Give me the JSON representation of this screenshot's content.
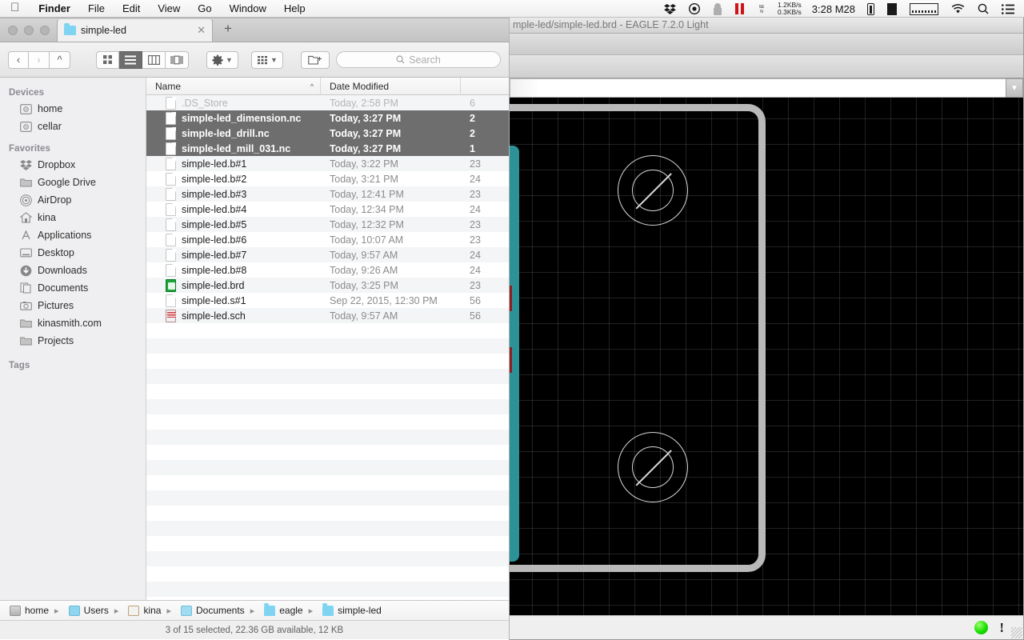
{
  "menubar": {
    "apple_icon": "apple-logo-icon",
    "items": [
      {
        "label": "Finder",
        "bold": true
      },
      {
        "label": "File",
        "bold": false
      },
      {
        "label": "Edit",
        "bold": false
      },
      {
        "label": "View",
        "bold": false
      },
      {
        "label": "Go",
        "bold": false
      },
      {
        "label": "Window",
        "bold": false
      },
      {
        "label": "Help",
        "bold": false
      }
    ],
    "status_icons": [
      "dropbox-icon",
      "record-circle-icon",
      "lock-icon",
      "pause-icon",
      "text-widget-icon"
    ],
    "network_up": "1.2KB/s",
    "network_down": "0.3KB/s",
    "clock": "3:28 M28",
    "right_icons": [
      "battery-icon",
      "black-box-icon",
      "activity-graph-icon",
      "wifi-icon",
      "search-icon",
      "notification-center-icon"
    ]
  },
  "finder": {
    "tab": {
      "title": "simple-led",
      "folder_icon": "folder-icon",
      "close_icon": "close-icon",
      "new_tab_icon": "plus-icon"
    },
    "toolbar": {
      "back_icon": "chevron-left-icon",
      "forward_icon": "chevron-right-icon",
      "up_icon": "chevron-up-icon",
      "view_modes": [
        {
          "name": "icon-view",
          "icon": "grid-icon",
          "active": false
        },
        {
          "name": "list-view",
          "icon": "list-icon",
          "active": true
        },
        {
          "name": "column-view",
          "icon": "columns-icon",
          "active": false
        },
        {
          "name": "coverflow-view",
          "icon": "coverflow-icon",
          "active": false
        }
      ],
      "action_icon": "gear-icon",
      "arrange_icon": "arrange-icon",
      "new_folder_icon": "new-folder-icon",
      "search_placeholder": "Search",
      "search_icon": "search-icon"
    },
    "sidebar": {
      "sections": [
        {
          "heading": "Devices",
          "items": [
            {
              "label": "home",
              "icon": "harddisk-icon"
            },
            {
              "label": "cellar",
              "icon": "harddisk-icon"
            }
          ]
        },
        {
          "heading": "Favorites",
          "items": [
            {
              "label": "Dropbox",
              "icon": "dropbox-icon"
            },
            {
              "label": "Google Drive",
              "icon": "folder-icon"
            },
            {
              "label": "AirDrop",
              "icon": "airdrop-icon"
            },
            {
              "label": "kina",
              "icon": "home-icon"
            },
            {
              "label": "Applications",
              "icon": "applications-icon"
            },
            {
              "label": "Desktop",
              "icon": "desktop-icon"
            },
            {
              "label": "Downloads",
              "icon": "downloads-icon"
            },
            {
              "label": "Documents",
              "icon": "documents-icon"
            },
            {
              "label": "Pictures",
              "icon": "pictures-icon"
            },
            {
              "label": "kinasmith.com",
              "icon": "folder-icon"
            },
            {
              "label": "Projects",
              "icon": "folder-icon"
            }
          ]
        },
        {
          "heading": "Tags",
          "items": []
        }
      ]
    },
    "columns": [
      {
        "label": "Name",
        "sort": "ascending",
        "sort_icon": "chevron-up-icon"
      },
      {
        "label": "Date Modified",
        "sort": null
      },
      {
        "label": "",
        "sort": null
      }
    ],
    "files": [
      {
        "name": ".DS_Store",
        "date": "Today, 2:58 PM",
        "size": "6",
        "icon": "document-icon",
        "selected": false,
        "dimmed": true
      },
      {
        "name": "simple-led_dimension.nc",
        "date": "Today, 3:27 PM",
        "size": "2",
        "icon": "document-icon",
        "selected": true,
        "dimmed": false
      },
      {
        "name": "simple-led_drill.nc",
        "date": "Today, 3:27 PM",
        "size": "2",
        "icon": "document-icon",
        "selected": true,
        "dimmed": false
      },
      {
        "name": "simple-led_mill_031.nc",
        "date": "Today, 3:27 PM",
        "size": "1",
        "icon": "document-icon",
        "selected": true,
        "dimmed": false
      },
      {
        "name": "simple-led.b#1",
        "date": "Today, 3:22 PM",
        "size": "23",
        "icon": "document-icon",
        "selected": false,
        "dimmed": false
      },
      {
        "name": "simple-led.b#2",
        "date": "Today, 3:21 PM",
        "size": "24",
        "icon": "document-icon",
        "selected": false,
        "dimmed": false
      },
      {
        "name": "simple-led.b#3",
        "date": "Today, 12:41 PM",
        "size": "23",
        "icon": "document-icon",
        "selected": false,
        "dimmed": false
      },
      {
        "name": "simple-led.b#4",
        "date": "Today, 12:34 PM",
        "size": "24",
        "icon": "document-icon",
        "selected": false,
        "dimmed": false
      },
      {
        "name": "simple-led.b#5",
        "date": "Today, 12:32 PM",
        "size": "23",
        "icon": "document-icon",
        "selected": false,
        "dimmed": false
      },
      {
        "name": "simple-led.b#6",
        "date": "Today, 10:07 AM",
        "size": "23",
        "icon": "document-icon",
        "selected": false,
        "dimmed": false
      },
      {
        "name": "simple-led.b#7",
        "date": "Today, 9:57 AM",
        "size": "24",
        "icon": "document-icon",
        "selected": false,
        "dimmed": false
      },
      {
        "name": "simple-led.b#8",
        "date": "Today, 9:26 AM",
        "size": "24",
        "icon": "document-icon",
        "selected": false,
        "dimmed": false
      },
      {
        "name": "simple-led.brd",
        "date": "Today, 3:25 PM",
        "size": "23",
        "icon": "eagle-board-icon",
        "selected": false,
        "dimmed": false
      },
      {
        "name": "simple-led.s#1",
        "date": "Sep 22, 2015, 12:30 PM",
        "size": "56",
        "icon": "document-icon",
        "selected": false,
        "dimmed": false
      },
      {
        "name": "simple-led.sch",
        "date": "Today, 9:57 AM",
        "size": "56",
        "icon": "eagle-schematic-icon",
        "selected": false,
        "dimmed": false
      }
    ],
    "breadcrumb": [
      {
        "label": "home",
        "icon": "harddisk-icon"
      },
      {
        "label": "Users",
        "icon": "users-folder-icon"
      },
      {
        "label": "kina",
        "icon": "home-folder-icon"
      },
      {
        "label": "Documents",
        "icon": "documents-folder-icon"
      },
      {
        "label": "eagle",
        "icon": "folder-icon"
      },
      {
        "label": "simple-led",
        "icon": "folder-icon"
      }
    ],
    "status": "3 of 15 selected, 22.36 GB available, 12 KB"
  },
  "eagle": {
    "title": "mple-led/simple-led.brd - EAGLE 7.2.0 Light",
    "command_dropdown_icon": "chevron-down-icon",
    "status_led": "green-status-led",
    "status_warning_icon": "exclamation-icon",
    "colors": {
      "canvas_background": "#000000",
      "board_outline": "#b9b9b9",
      "trace_top": "#2d9298",
      "pad_bottom": "#8c2024",
      "grid": "#222222"
    }
  }
}
